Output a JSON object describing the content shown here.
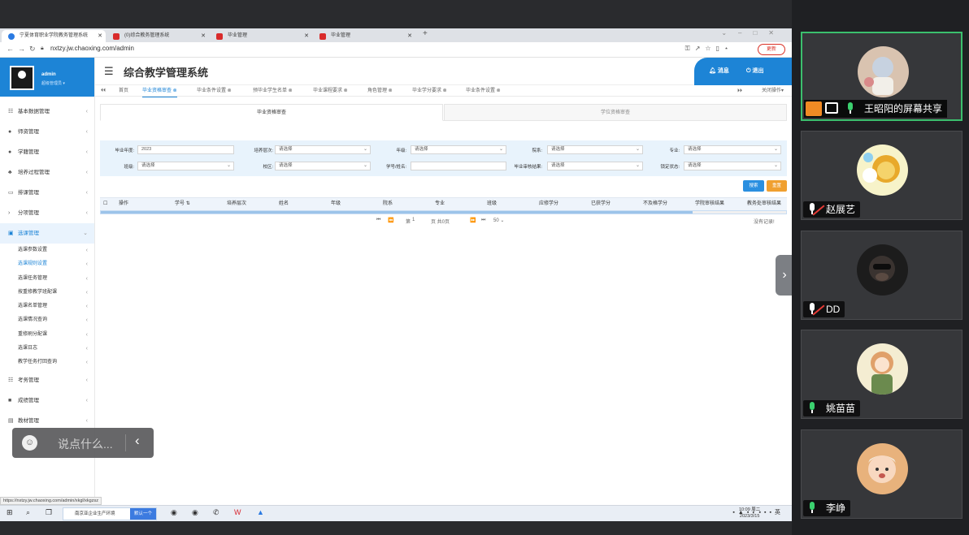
{
  "browser": {
    "tabs": [
      {
        "label": "宁夏体育职业学院教务管理系统"
      },
      {
        "label": "(0)综合教务管理系统"
      },
      {
        "label": "毕业管理"
      },
      {
        "label": "毕业管理"
      }
    ],
    "url": "nxtzy.jw.chaoxing.com/admin",
    "update_label": "更新"
  },
  "sidebar": {
    "user_name": "admin",
    "user_role": "超级管理员 ▾",
    "menu_top": [
      {
        "label": "基本数据管理"
      },
      {
        "label": "师资管理"
      },
      {
        "label": "学籍管理"
      },
      {
        "label": "培养过程管理"
      },
      {
        "label": "排课管理"
      },
      {
        "label": "分项管理"
      },
      {
        "label": "选课管理"
      }
    ],
    "submenu": [
      {
        "label": "选课参数设置"
      },
      {
        "label": "选课规则设置"
      },
      {
        "label": "选课任务管理"
      },
      {
        "label": "按重修教学班配课"
      },
      {
        "label": "选课名单管理"
      },
      {
        "label": "选课情况查询"
      },
      {
        "label": "重修刷分配课"
      },
      {
        "label": "选课日志"
      },
      {
        "label": "教学任务打回查询"
      }
    ],
    "menu_bottom": [
      {
        "label": "考务管理"
      },
      {
        "label": "成绩管理"
      },
      {
        "label": "教材管理"
      }
    ]
  },
  "header": {
    "title": "综合教学管理系统",
    "messages_label": "消息",
    "logout_label": "退出"
  },
  "page_tabs": [
    {
      "label": "首页"
    },
    {
      "label": "毕业资格审查"
    },
    {
      "label": "毕业条件设置"
    },
    {
      "label": "预毕业学生名单"
    },
    {
      "label": "毕业课程要求"
    },
    {
      "label": "角色管理"
    },
    {
      "label": "毕业学分要求"
    },
    {
      "label": "毕业条件设置"
    }
  ],
  "close_ops": "关闭操作▾",
  "sub_tabs": [
    {
      "label": "毕业资格审查"
    },
    {
      "label": "学位资格审查"
    }
  ],
  "filters": {
    "grad_year_label": "毕业年度:",
    "grad_year_value": "2023",
    "level_label": "培养层次:",
    "grade_label": "年级:",
    "dept_label": "院系:",
    "major_label": "专业:",
    "class_label": "班级:",
    "campus_label": "校区:",
    "stuno_label": "学号/姓名:",
    "audit_result_label": "毕业审核结果:",
    "lock_label": "锁定状态:",
    "select_placeholder": "请选择",
    "search_label": "搜索",
    "reset_label": "重置"
  },
  "table": {
    "columns": [
      "操作",
      "学号",
      "培养层次",
      "姓名",
      "年级",
      "院系",
      "专业",
      "班级",
      "应修学分",
      "已获学分",
      "不及格学分",
      "学院审核结果",
      "教务处审核结果"
    ]
  },
  "pager": {
    "page_prefix": "第",
    "page_value": "1",
    "page_suffix": "页 共0页",
    "page_size": "50",
    "no_records": "没有记录!"
  },
  "status_url": "https://nxtzy.jw.chaoxing.com/admin/xkgl/xkgzsz",
  "chat": {
    "placeholder": "说点什么..."
  },
  "taskbar": {
    "app_label": "南京亚企业生产环境",
    "app_badge": "默认一个",
    "time": "10:09 周二",
    "date": "2023/3/15",
    "ime": "英"
  },
  "participants": [
    {
      "name": "王昭阳的屏幕共享",
      "mic": "on",
      "speaking": true
    },
    {
      "name": "赵展艺",
      "mic": "muted"
    },
    {
      "name": "DD",
      "mic": "muted"
    },
    {
      "name": "姚苗苗",
      "mic": "on"
    },
    {
      "name": "李峥",
      "mic": "on"
    }
  ],
  "colors": {
    "brand": "#1d84d6",
    "speaking_border": "#3bbf6d",
    "search_btn": "#2a8fe0",
    "reset_btn": "#f0a030"
  }
}
